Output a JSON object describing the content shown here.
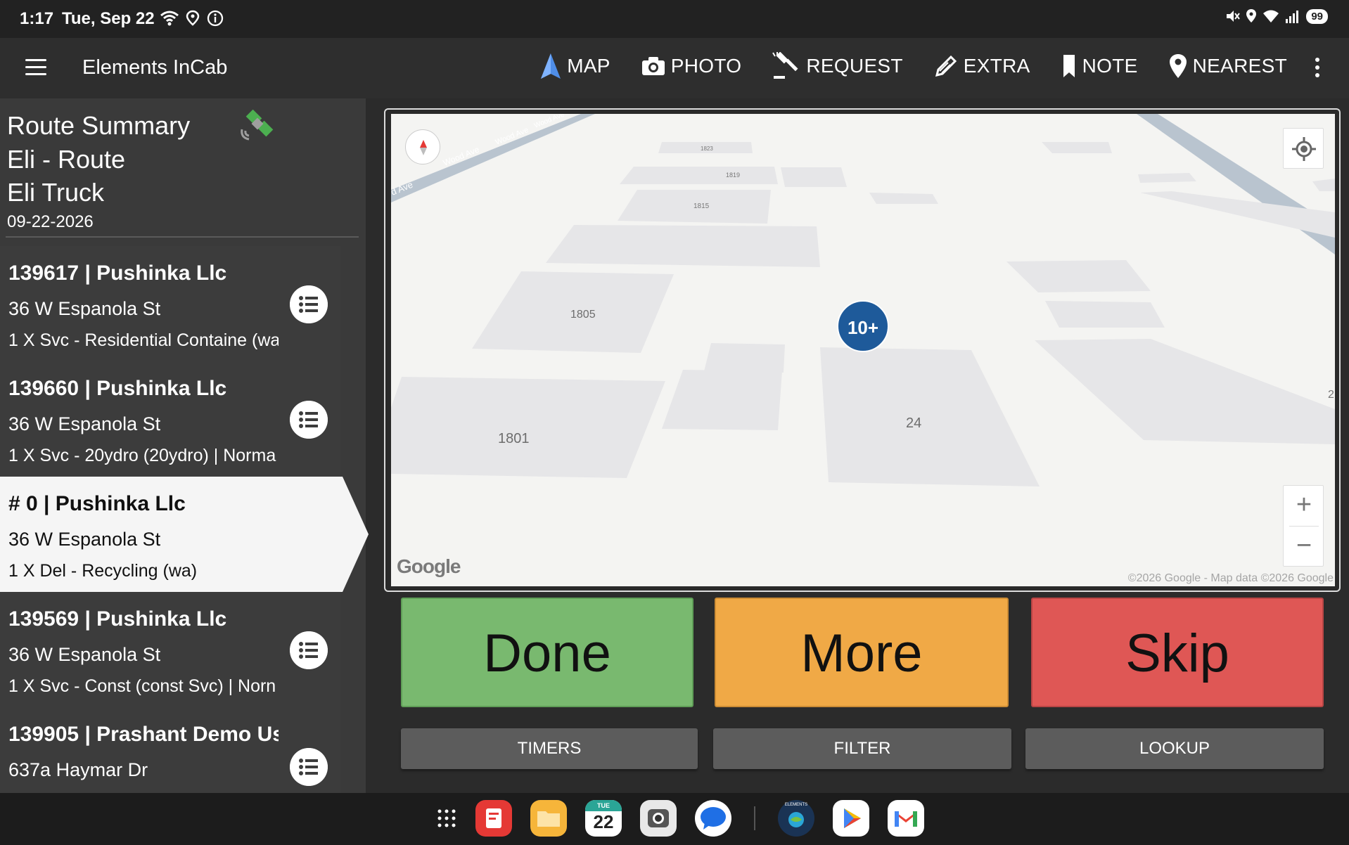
{
  "status": {
    "time": "1:17",
    "date": "Tue, Sep 22",
    "battery": "99"
  },
  "appbar": {
    "title": "Elements InCab",
    "actions": [
      {
        "label": "MAP",
        "icon": "navigation-arrow-icon"
      },
      {
        "label": "PHOTO",
        "icon": "camera-icon"
      },
      {
        "label": "REQUEST",
        "icon": "gavel-icon"
      },
      {
        "label": "EXTRA",
        "icon": "pencil-icon"
      },
      {
        "label": "NOTE",
        "icon": "bookmark-icon"
      },
      {
        "label": "NEAREST",
        "icon": "location-pin-icon"
      }
    ]
  },
  "summary": {
    "title": "Route Summary",
    "route": "Eli - Route",
    "truck": "Eli Truck",
    "date": "09-22-2026"
  },
  "stops": [
    {
      "title": "139617 | Pushinka Llc",
      "address": "36 W Espanola St",
      "service": "1 X Svc - Residential Containe (wa",
      "active": false
    },
    {
      "title": "139660 | Pushinka Llc",
      "address": "36 W Espanola St",
      "service": "1 X Svc - 20ydro (20ydro) | Norma",
      "active": false
    },
    {
      "title": "# 0 | Pushinka Llc",
      "address": "36 W Espanola St",
      "service": "1 X Del - Recycling (wa)",
      "active": true
    },
    {
      "title": "139569 | Pushinka Llc",
      "address": "36 W Espanola St",
      "service": "1 X Svc - Const (const Svc) | Norn",
      "active": false
    },
    {
      "title": "139905 | Prashant Demo Us",
      "address": "637a Haymar Dr",
      "service": "",
      "active": false
    }
  ],
  "map": {
    "cluster": "10+",
    "street": "Wood Ave",
    "street_prefix": "d Ave",
    "numbers": [
      "1805",
      "1801",
      "24",
      "1815",
      "1819",
      "1823",
      "2"
    ],
    "logo": "Google",
    "attribution": "©2026 Google - Map data ©2026 Google",
    "zoom_in": "+",
    "zoom_out": "−"
  },
  "buttons": {
    "done": "Done",
    "more": "More",
    "skip": "Skip",
    "timers": "TIMERS",
    "filter": "FILTER",
    "lookup": "LOOKUP"
  },
  "dock": {
    "calendar_day": "TUE",
    "calendar_date": "22",
    "incab_label": "ELEMENTS"
  },
  "colors": {
    "done": "#79b96f",
    "more": "#f0a946",
    "skip": "#df5755",
    "cluster": "#1e5a9a",
    "gps": "#4caf50"
  }
}
